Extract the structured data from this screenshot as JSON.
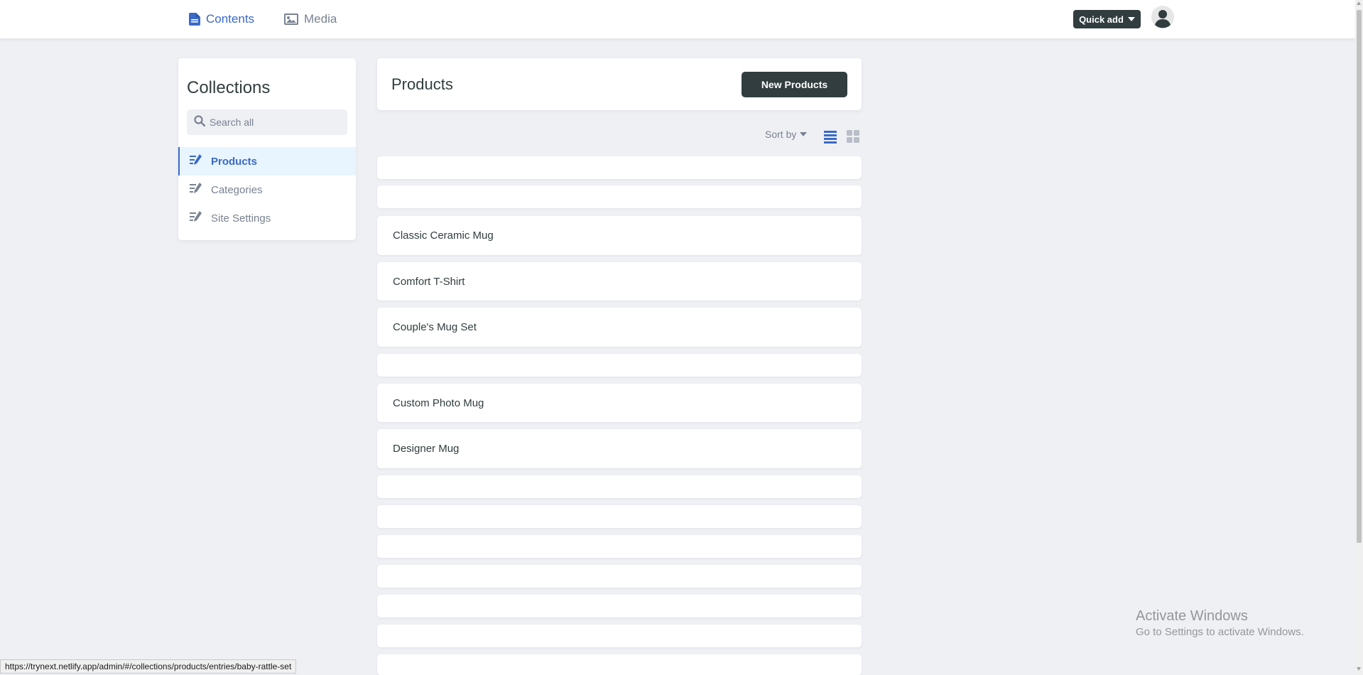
{
  "nav": {
    "contents_label": "Contents",
    "media_label": "Media",
    "quick_add_label": "Quick add",
    "active_color": "#3a69c7"
  },
  "sidebar": {
    "title": "Collections",
    "search_placeholder": "Search all",
    "items": [
      {
        "label": "Products",
        "icon": "edit-list-icon",
        "active": true
      },
      {
        "label": "Categories",
        "icon": "edit-list-icon",
        "active": false
      },
      {
        "label": "Site Settings",
        "icon": "edit-list-icon",
        "active": false
      }
    ]
  },
  "main": {
    "title": "Products",
    "new_button_label": "New Products",
    "sort_label": "Sort by",
    "view_modes": [
      "list-view-icon",
      "grid-view-icon"
    ],
    "active_view": "list-view-icon",
    "entries": [
      {
        "label": ""
      },
      {
        "label": ""
      },
      {
        "label": "Classic Ceramic Mug"
      },
      {
        "label": "Comfort T-Shirt"
      },
      {
        "label": "Couple's Mug Set"
      },
      {
        "label": ""
      },
      {
        "label": "Custom Photo Mug"
      },
      {
        "label": "Designer Mug"
      },
      {
        "label": ""
      },
      {
        "label": ""
      },
      {
        "label": ""
      },
      {
        "label": ""
      },
      {
        "label": ""
      },
      {
        "label": ""
      },
      {
        "label": ""
      }
    ]
  },
  "status_bar": {
    "url": "https://trynext.netlify.app/admin/#/collections/products/entries/baby-rattle-set"
  },
  "watermark": {
    "title": "Activate Windows",
    "subtitle": "Go to Settings to activate Windows."
  },
  "colors": {
    "background": "#eff0f4",
    "dark_button": "#313d3e",
    "muted_text": "#798291",
    "accent": "#3a69c7"
  }
}
